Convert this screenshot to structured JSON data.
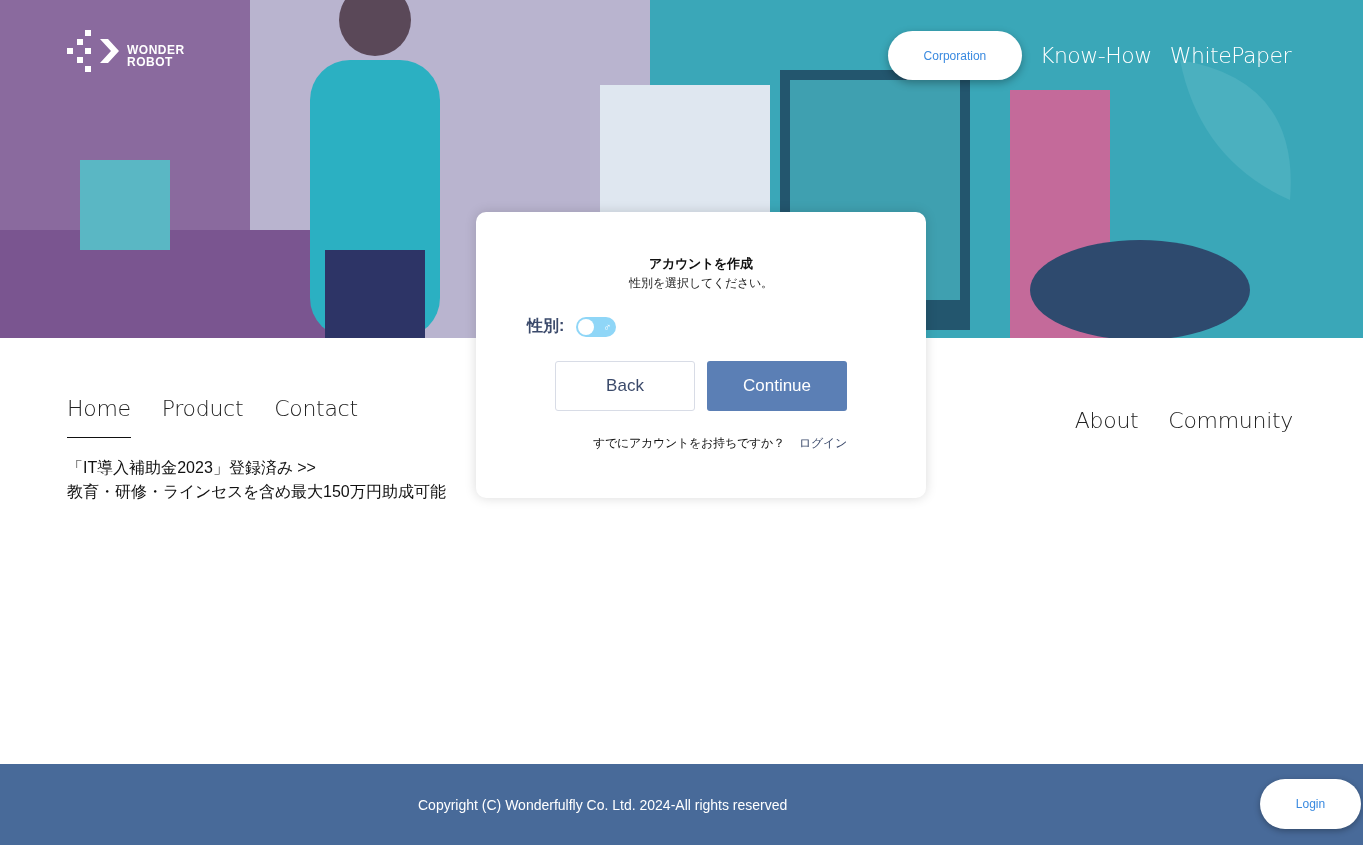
{
  "header": {
    "logo": {
      "line_1": "WONDER",
      "line_2": "ROBOT"
    },
    "corporation_button": "Corporation",
    "links": [
      "Know-How",
      "WhitePaper"
    ]
  },
  "nav_left": [
    {
      "label": "Home",
      "selected": true
    },
    {
      "label": "Product",
      "selected": false
    },
    {
      "label": "Contact",
      "selected": false
    }
  ],
  "nav_right": [
    {
      "label": "About",
      "selected": false
    },
    {
      "label": "Community",
      "selected": false
    }
  ],
  "notice": [
    "「IT導入補助金2023」登録済み >>",
    "教育・研修・ラインセスを含め最大150万円助成可能"
  ],
  "dialog": {
    "title": "アカウントを作成",
    "subtitle": "性別を選択してください。",
    "gender": {
      "label": "性別:",
      "symbol": "♂",
      "on": false
    },
    "buttons": [
      {
        "label": "Back",
        "kind": "secondary"
      },
      {
        "label": "Continue",
        "kind": "primary"
      }
    ],
    "prompt": "すでにアカウントをお持ちですか？",
    "login_link": "ログイン"
  },
  "footer": {
    "copyright": "Copyright (C) Wonderfulfly Co. Ltd. 2024-All rights reserved",
    "login_button": "Login"
  }
}
